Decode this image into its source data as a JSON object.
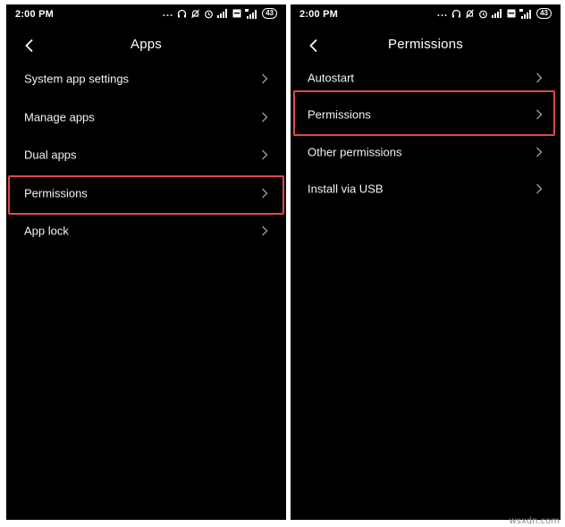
{
  "left_screen": {
    "status": {
      "time": "2:00 PM",
      "dots": "...",
      "battery": "43"
    },
    "header": {
      "title": "Apps"
    },
    "items": [
      {
        "label": "System app settings"
      },
      {
        "label": "Manage apps"
      },
      {
        "label": "Dual apps"
      },
      {
        "label": "Permissions"
      },
      {
        "label": "App lock"
      }
    ]
  },
  "right_screen": {
    "status": {
      "time": "2:00 PM",
      "dots": "...",
      "battery": "43"
    },
    "header": {
      "title": "Permissions"
    },
    "items": [
      {
        "label": "Autostart"
      },
      {
        "label": "Permissions"
      },
      {
        "label": "Other permissions"
      },
      {
        "label": "Install via USB"
      }
    ]
  },
  "highlight_color": "#e0484a",
  "watermark": "wsxdn.com"
}
